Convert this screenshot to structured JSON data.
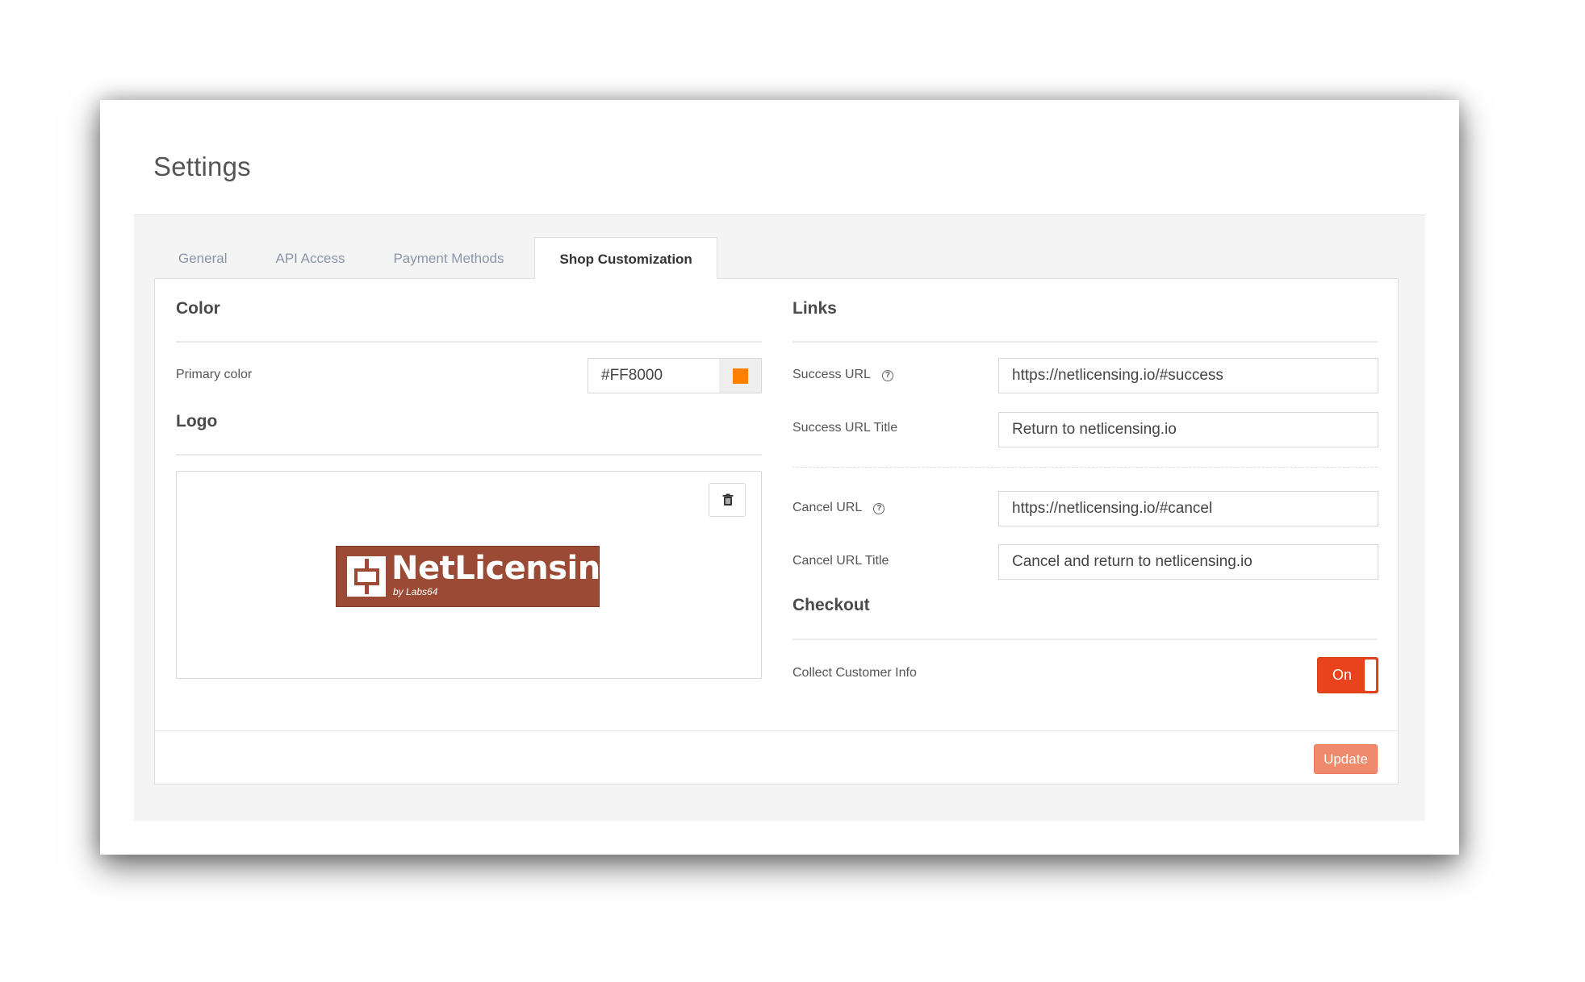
{
  "page": {
    "title": "Settings"
  },
  "tabs": [
    {
      "label": "General"
    },
    {
      "label": "API Access"
    },
    {
      "label": "Payment Methods"
    },
    {
      "label": "Shop Customization"
    }
  ],
  "active_tab": "Shop Customization",
  "color_section": {
    "title": "Color",
    "primary_color_label": "Primary color",
    "primary_color_value": "#FF8000",
    "swatch_color": "#FF8000"
  },
  "logo_section": {
    "title": "Logo",
    "logo_name": "NetLicensing",
    "logo_tagline": "by Labs64",
    "delete_icon": "trash-icon"
  },
  "links_section": {
    "title": "Links",
    "success_url_label": "Success URL",
    "success_url_value": "https://netlicensing.io/#success",
    "success_title_label": "Success URL Title",
    "success_title_value": "Return to netlicensing.io",
    "cancel_url_label": "Cancel URL",
    "cancel_url_value": "https://netlicensing.io/#cancel",
    "cancel_title_label": "Cancel URL Title",
    "cancel_title_value": "Cancel and return to netlicensing.io",
    "help_icon": "question-circle-icon",
    "help_glyph": "?"
  },
  "checkout_section": {
    "title": "Checkout",
    "collect_info_label": "Collect Customer Info",
    "toggle_label": "On",
    "toggle_state": "on"
  },
  "footer": {
    "update_label": "Update"
  },
  "colors": {
    "accent": "#E8431D",
    "update_button": "#F08A6C",
    "logo_bg": "#9A4A35"
  }
}
